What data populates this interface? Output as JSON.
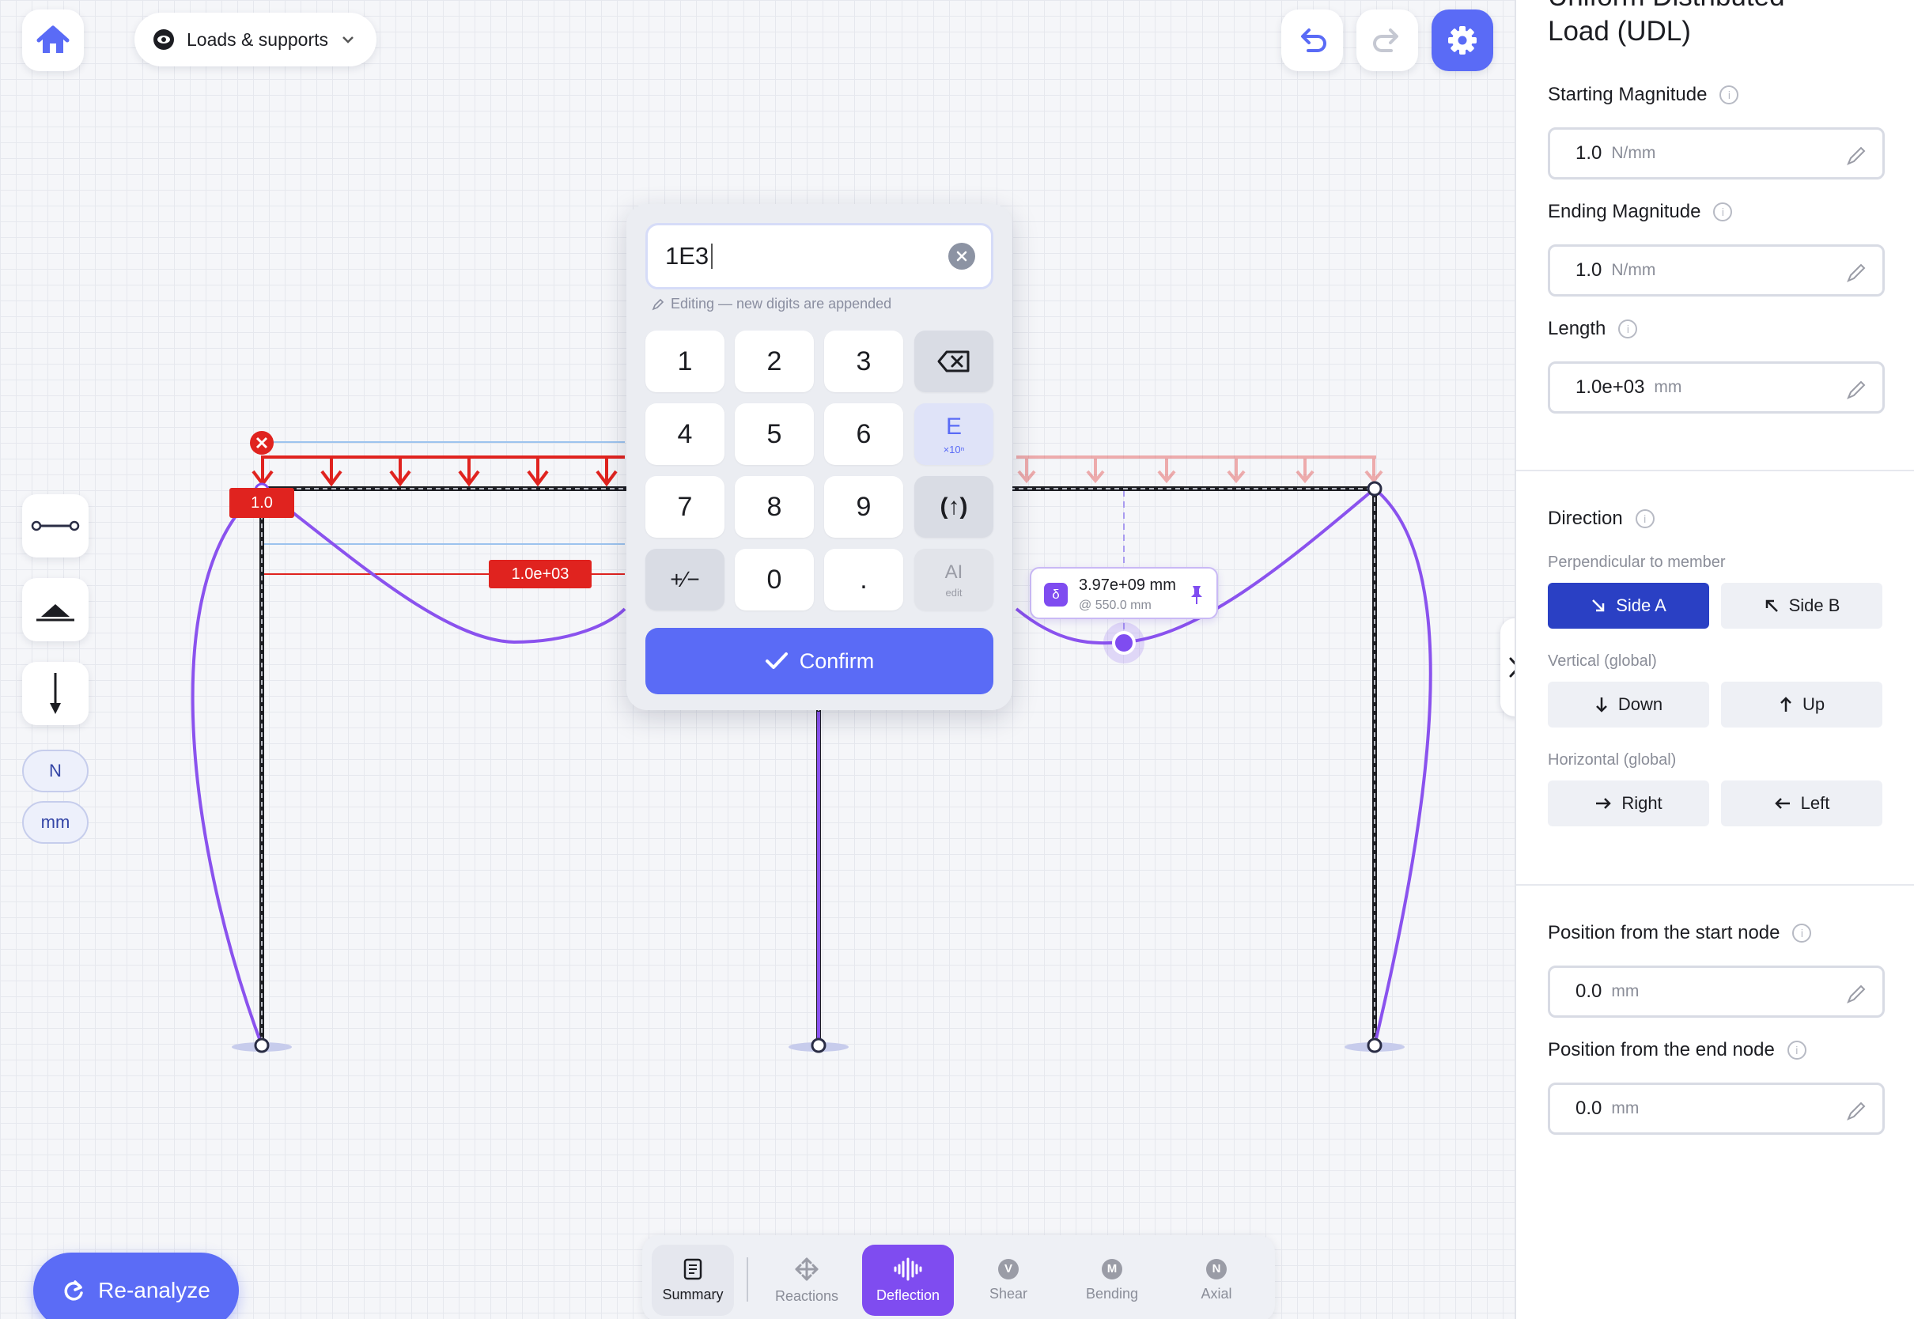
{
  "toolbar": {
    "view_mode_label": "Loads & supports"
  },
  "left_tools": {
    "unit_force": "N",
    "unit_length": "mm"
  },
  "canvas": {
    "load_tag": "1.0",
    "length_tag": "1.0e+03",
    "deflection_tooltip": {
      "symbol": "δ",
      "value": "3.97e+09 mm",
      "position": "@ 550.0 mm"
    }
  },
  "keypad": {
    "display_value": "1E3",
    "hint": "Editing — new digits are appended",
    "keys": {
      "k1": "1",
      "k2": "2",
      "k3": "3",
      "k4": "4",
      "k5": "5",
      "k6": "6",
      "k7": "7",
      "k8": "8",
      "k9": "9",
      "k0": "0",
      "kdot": ".",
      "exp_main": "E",
      "exp_sub": "×10ⁿ",
      "paren": "(↑)",
      "sign": "+∕−",
      "edit_main": "AI",
      "edit_sub": "edit"
    },
    "confirm_label": "Confirm"
  },
  "results_bar": {
    "tabs": [
      {
        "label": "Summary"
      },
      {
        "label": "Reactions"
      },
      {
        "label": "Deflection"
      },
      {
        "label": "Shear",
        "badge": "V"
      },
      {
        "label": "Bending",
        "badge": "M"
      },
      {
        "label": "Axial",
        "badge": "N"
      }
    ]
  },
  "reanalyze_label": "Re-analyze",
  "panel": {
    "title_line1": "Uniform Distributed",
    "title_line2": "Load (UDL)",
    "starting_magnitude": {
      "label": "Starting Magnitude",
      "value": "1.0",
      "unit": "N/mm"
    },
    "ending_magnitude": {
      "label": "Ending Magnitude",
      "value": "1.0",
      "unit": "N/mm"
    },
    "length": {
      "label": "Length",
      "value": "1.0e+03",
      "unit": "mm"
    },
    "direction": {
      "label": "Direction",
      "perpendicular_label": "Perpendicular to member",
      "side_a": "Side A",
      "side_b": "Side B",
      "vertical_label": "Vertical (global)",
      "down": "Down",
      "up": "Up",
      "horizontal_label": "Horizontal (global)",
      "right": "Right",
      "left": "Left"
    },
    "pos_start": {
      "label": "Position from the start node",
      "value": "0.0",
      "unit": "mm"
    },
    "pos_end": {
      "label": "Position from the end node",
      "value": "0.0",
      "unit": "mm"
    }
  },
  "colors": {
    "accent": "#5a6bf6",
    "deflection": "#7f4cf0",
    "load": "#e0231f",
    "selected_direction": "#2a40c4"
  }
}
